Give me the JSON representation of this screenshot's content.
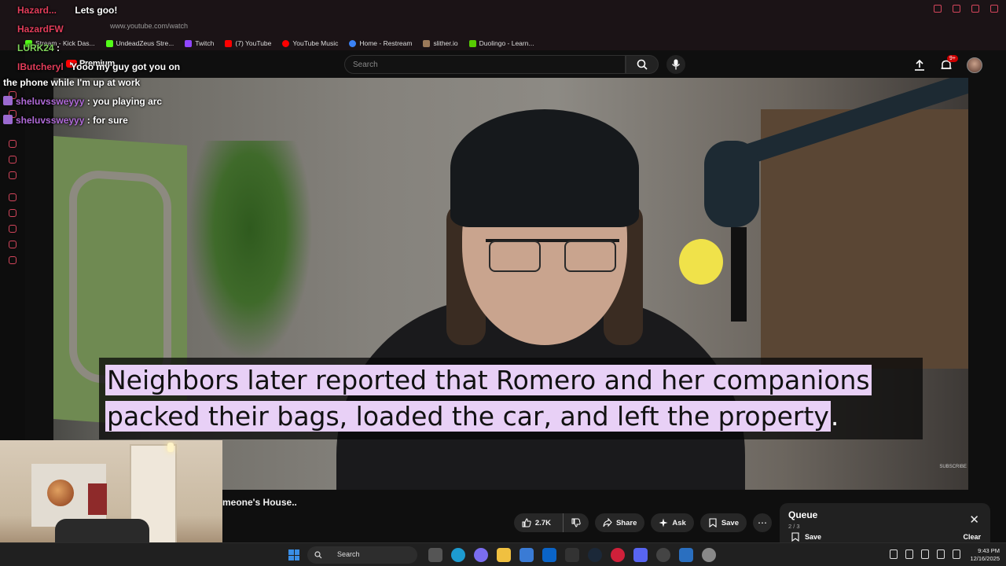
{
  "browser": {
    "url": "www.youtube.com/watch",
    "bookmarks": [
      {
        "label": "Stream - Kick Das...",
        "color": "#53fc18"
      },
      {
        "label": "UndeadZeus Stre...",
        "color": "#53fc18"
      },
      {
        "label": "Twitch",
        "color": "#9146ff"
      },
      {
        "label": "(7) YouTube",
        "color": "#ff0000"
      },
      {
        "label": "YouTube Music",
        "color": "#ff0000"
      },
      {
        "label": "Home - Restream",
        "color": "#3b82f6"
      },
      {
        "label": "slither.io",
        "color": "#9c7a5a"
      },
      {
        "label": "Duolingo - Learn...",
        "color": "#58cc02"
      }
    ]
  },
  "youtube": {
    "logo_text": "Premium",
    "search_placeholder": "Search",
    "notification_count": "9+",
    "caption_line1": "Neighbors later reported that Romero and her companions",
    "caption_line2": "packed their bags, loaded the car, and left the property",
    "caption_period": ".",
    "watermark": "SUBSCRIBE",
    "video_title": "meone's House..",
    "likes": "2.7K",
    "share_label": "Share",
    "ask_label": "Ask",
    "save_label": "Save",
    "queue": {
      "title": "Queue",
      "count": "2 / 3",
      "save_label": "Save",
      "clear_label": "Clear"
    }
  },
  "chat": [
    {
      "user": "Hazard...",
      "message": "Lets goo!",
      "user_color": "#e23d5a"
    },
    {
      "user": "HazardFW",
      "message": "",
      "user_color": "#e23d5a"
    },
    {
      "user": "LURK24",
      "message": ":",
      "user_color": "#7fd35a"
    },
    {
      "user": "IButcheryl",
      "message": "Yooo my guy got you on",
      "user_color": "#e23d5a"
    },
    {
      "user": "",
      "message": "the phone while I'm up at work",
      "user_color": "#e23d5a"
    },
    {
      "user": "sheluvssweyyy",
      "message": ": you playing arc",
      "user_color": "#b06ad8"
    },
    {
      "user": "sheluvssweyyy",
      "message": ": for sure",
      "user_color": "#b06ad8"
    }
  ],
  "taskbar": {
    "search_label": "Search",
    "time": "9:43 PM",
    "date": "12/16/2025"
  }
}
